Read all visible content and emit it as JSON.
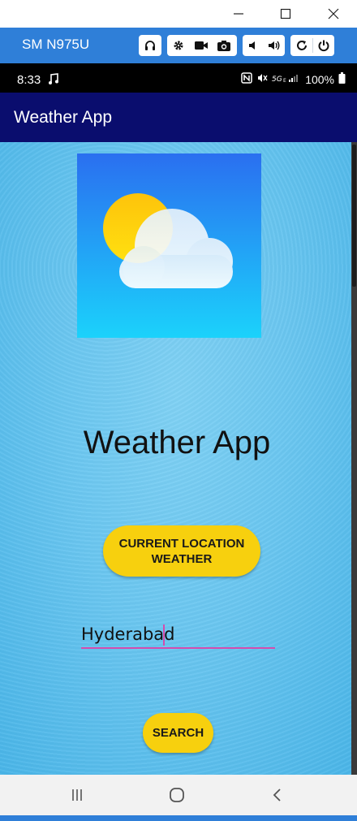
{
  "window": {
    "minimize_icon": "minimize-icon",
    "maximize_icon": "maximize-icon",
    "close_icon": "close-icon"
  },
  "toolbar": {
    "device_name": "SM N975U",
    "icons": [
      "headphones-icon",
      "gear-icon",
      "video-camera-icon",
      "camera-icon",
      "volume-down-icon",
      "volume-up-icon",
      "rotate-icon",
      "power-icon"
    ],
    "accent": "#2f7fd8"
  },
  "status_bar": {
    "time": "8:33",
    "battery": "100%",
    "icons": [
      "music-note-icon",
      "nfc-icon",
      "mute-icon",
      "signal-5g-icon",
      "battery-icon"
    ]
  },
  "app_bar": {
    "title": "Weather App",
    "color": "#0a0d6e"
  },
  "main": {
    "logo_icon": "weather-sun-cloud-icon",
    "heading": "Weather App",
    "location_button": "CURRENT LOCATION WEATHER",
    "city_input_value": "Hyderabad",
    "search_button": "SEARCH",
    "button_color": "#f7d00e",
    "input_underline_color": "#d44cae"
  },
  "nav_bar": {
    "icons": [
      "recent-apps-icon",
      "home-icon",
      "back-icon"
    ]
  }
}
